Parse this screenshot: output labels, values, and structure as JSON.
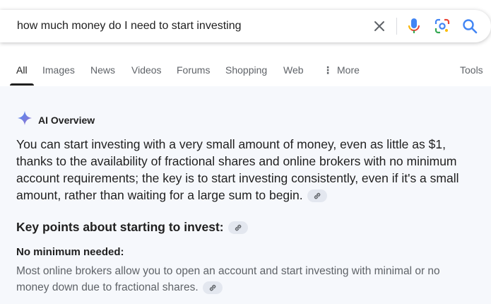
{
  "search": {
    "query": "how much money do I need to start investing"
  },
  "tabs": [
    {
      "label": "All",
      "active": true
    },
    {
      "label": "Images"
    },
    {
      "label": "News"
    },
    {
      "label": "Videos"
    },
    {
      "label": "Forums"
    },
    {
      "label": "Shopping"
    },
    {
      "label": "Web"
    },
    {
      "label": "More"
    }
  ],
  "tools_label": "Tools",
  "ai_overview": {
    "label": "AI Overview",
    "summary": "You can start investing with a very small amount of money, even as little as $1, thanks to the availability of fractional shares and online brokers with no minimum account requirements; the key is to start investing consistently, even if it's a small amount, rather than waiting for a large sum to begin.",
    "key_points_heading": "Key points about starting to invest:",
    "point_title": "No minimum needed:",
    "point_text": "Most online brokers allow you to open an account and start investing with minimal or no money down due to fractional shares."
  },
  "colors": {
    "accent_blue": "#4285f4",
    "mic_red": "#ea4335",
    "ai_background": "#f6f8fc"
  },
  "icons": {
    "clear": "close-icon",
    "mic": "microphone-icon",
    "lens": "camera-lens-icon",
    "search": "search-icon",
    "ai": "sparkle-icon",
    "link": "link-icon"
  }
}
